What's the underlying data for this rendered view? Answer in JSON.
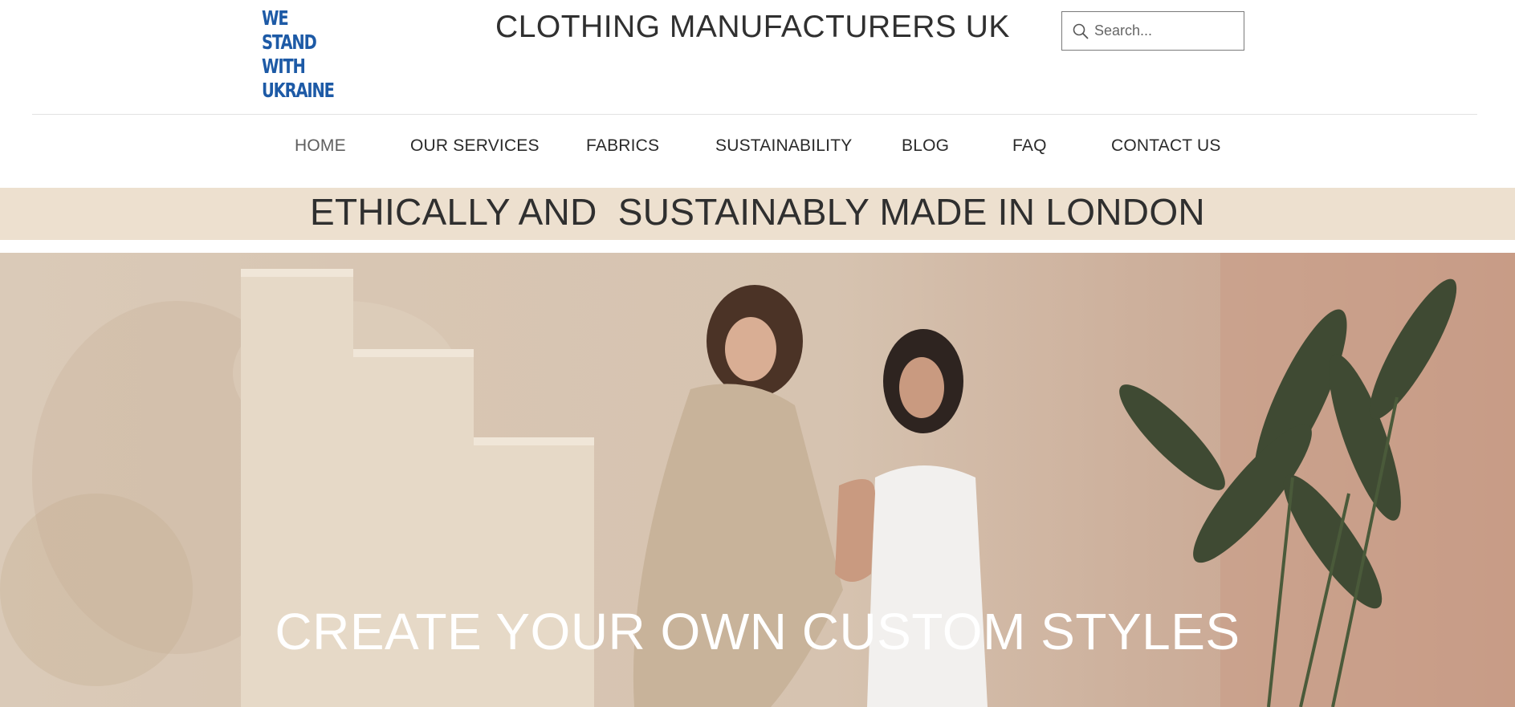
{
  "logo": {
    "lines": [
      "WE STAND",
      "WITH",
      "UKRAINE"
    ],
    "color": "#1d5aa6"
  },
  "header": {
    "site_title": "CLOTHING MANUFACTURERS UK"
  },
  "search": {
    "placeholder": "Search...",
    "icon": "search-icon"
  },
  "nav": {
    "items": [
      {
        "label": "HOME",
        "active": true
      },
      {
        "label": "OUR SERVICES"
      },
      {
        "label": "FABRICS"
      },
      {
        "label": "SUSTAINABILITY"
      },
      {
        "label": "BLOG"
      },
      {
        "label": "FAQ"
      },
      {
        "label": "CONTACT US"
      }
    ]
  },
  "banner": {
    "text": "ETHICALLY AND  SUSTAINABLY MADE IN LONDON",
    "background": "#ede0cf"
  },
  "hero": {
    "caption": "CREATE YOUR OWN CUSTOM STYLES"
  }
}
